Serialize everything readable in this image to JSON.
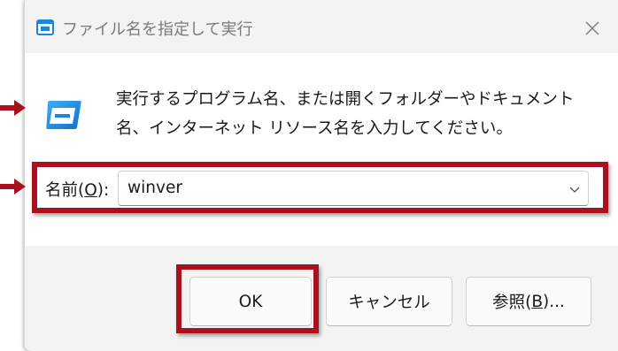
{
  "window": {
    "title": "ファイル名を指定して実行",
    "close_icon": "close-icon",
    "app_icon": "run-icon"
  },
  "dialog": {
    "description": "実行するプログラム名、または開くフォルダーやドキュメント名、インターネット リソース名を入力してください。",
    "name_label_prefix": "名前(",
    "name_label_access_key": "O",
    "name_label_suffix": "):",
    "name_value": "winver"
  },
  "buttons": {
    "ok": "OK",
    "cancel": "キャンセル",
    "browse_prefix": "参照(",
    "browse_access_key": "B",
    "browse_suffix": ")..."
  },
  "colors": {
    "annotation": "#a8111d",
    "icon_blue": "#1a86d8"
  }
}
